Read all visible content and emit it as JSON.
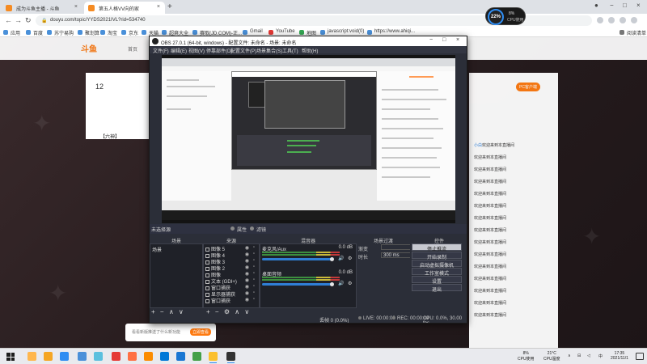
{
  "browser": {
    "tabs": [
      {
        "label": "成为斗鱼主播 - 斗鱼",
        "active": false
      },
      {
        "label": "第五人格VV向的家",
        "active": true
      }
    ],
    "address": "douyu.com/topic/YYDS2021IVL?rid=534740",
    "bookmarks": [
      "应用",
      "百度",
      "苏宁易购",
      "聚划算",
      "淘宝",
      "京东",
      "天猫",
      "超爽大全",
      "赛取(JD.COM)-正...",
      "Gmail",
      "YouTube",
      "地图",
      "javascript:void(0)",
      "https://www.ahiqi..."
    ],
    "reading_list": "阅读清单"
  },
  "site": {
    "logo": "斗鱼",
    "nav_home": "首页",
    "room_number": "12",
    "anchor_tag": "【六神】",
    "pc_button": "PC客户端",
    "banner_text": "看看新版推送了什么新功能",
    "banner_button": "立即查看",
    "chat": [
      {
        "user": "小白",
        "badge": "",
        "text": "欢迎来到本直播间"
      },
      {
        "user": "",
        "badge": "",
        "text": "欢迎来到本直播间"
      },
      {
        "user": "",
        "badge": "",
        "text": "欢迎来到本直播间"
      },
      {
        "user": "",
        "badge": "",
        "text": "欢迎来到本直播间"
      },
      {
        "user": "",
        "badge": "",
        "text": "欢迎来到本直播间"
      },
      {
        "user": "",
        "badge": "",
        "text": "欢迎来到本直播间"
      },
      {
        "user": "",
        "badge": "",
        "text": "欢迎来到本直播间"
      },
      {
        "user": "",
        "badge": "",
        "text": "欢迎来到本直播间"
      },
      {
        "user": "",
        "badge": "",
        "text": "欢迎来到本直播间"
      },
      {
        "user": "",
        "badge": "",
        "text": "欢迎来到本直播间"
      },
      {
        "user": "",
        "badge": "",
        "text": "欢迎来到本直播间"
      },
      {
        "user": "",
        "badge": "",
        "text": "欢迎来到本直播间"
      },
      {
        "user": "",
        "badge": "",
        "text": "欢迎来到本直播间"
      },
      {
        "user": "",
        "badge": "",
        "text": "欢迎来到本直播间"
      },
      {
        "user": "",
        "badge": "",
        "text": "欢迎来到本直播间"
      }
    ]
  },
  "obs": {
    "title": "OBS 27.0.1 (64-bit, windows) - 配置文件: 未命名 - 场景: 未命名",
    "menu": [
      "文件(F)",
      "编辑(E)",
      "视图(V)",
      "停靠部件(D)",
      "配置文件(P)",
      "场景集合(S)",
      "工具(T)",
      "帮助(H)"
    ],
    "tabs": [
      "属性",
      "滤镜"
    ],
    "unselected_label": "未选择源",
    "panels": {
      "scenes": "场景",
      "sources": "来源",
      "mixer": "混音器",
      "transitions": "场景过渡",
      "controls": "控件"
    },
    "scene_items": [
      "场景"
    ],
    "sources": [
      {
        "name": "图像 5"
      },
      {
        "name": "图像 4"
      },
      {
        "name": "图像 3"
      },
      {
        "name": "图像 2"
      },
      {
        "name": "图像"
      },
      {
        "name": "文本 (GDI+)"
      },
      {
        "name": "窗口捕获"
      },
      {
        "name": "显示器捕获"
      },
      {
        "name": "窗口捕获"
      }
    ],
    "mixer_tracks": [
      {
        "name": "桌面音频",
        "db": "0.0 dB"
      },
      {
        "name": "麦克风/Aux",
        "db": "0.0 dB"
      }
    ],
    "transition_type_label": "渐变",
    "transition_duration_label": "时长",
    "transition_duration_value": "300 ms",
    "controls": [
      "停止推流",
      "开始录制",
      "启动虚拟摄像机",
      "工作室模式",
      "设置",
      "退出"
    ],
    "status": {
      "dropped": "丢帧 0 (0.0%)",
      "live": "LIVE: 00:00:00",
      "rec": "REC: 00:00:00",
      "cpu": "CPU: 0.0%, 30.00 fps"
    },
    "toolbar_glyphs": [
      "+",
      "−",
      "∧",
      "∨"
    ],
    "source_toolbar_glyphs": [
      "+",
      "−",
      "⚙",
      "∧",
      "∨"
    ]
  },
  "cpu_widget": {
    "value": "22%",
    "sub1": "8%",
    "sub2": "CPU使用"
  },
  "taskbar": {
    "tray_cpu": "8%\nCPU使用",
    "tray_temp": "21°C\nCPU温度",
    "time": "17:35",
    "date": "2021/11/1",
    "lang": "中"
  },
  "colors": {
    "accent": "#2f8df2",
    "douyu_orange": "#ff7b12",
    "obs_bg": "#2b2e38"
  }
}
